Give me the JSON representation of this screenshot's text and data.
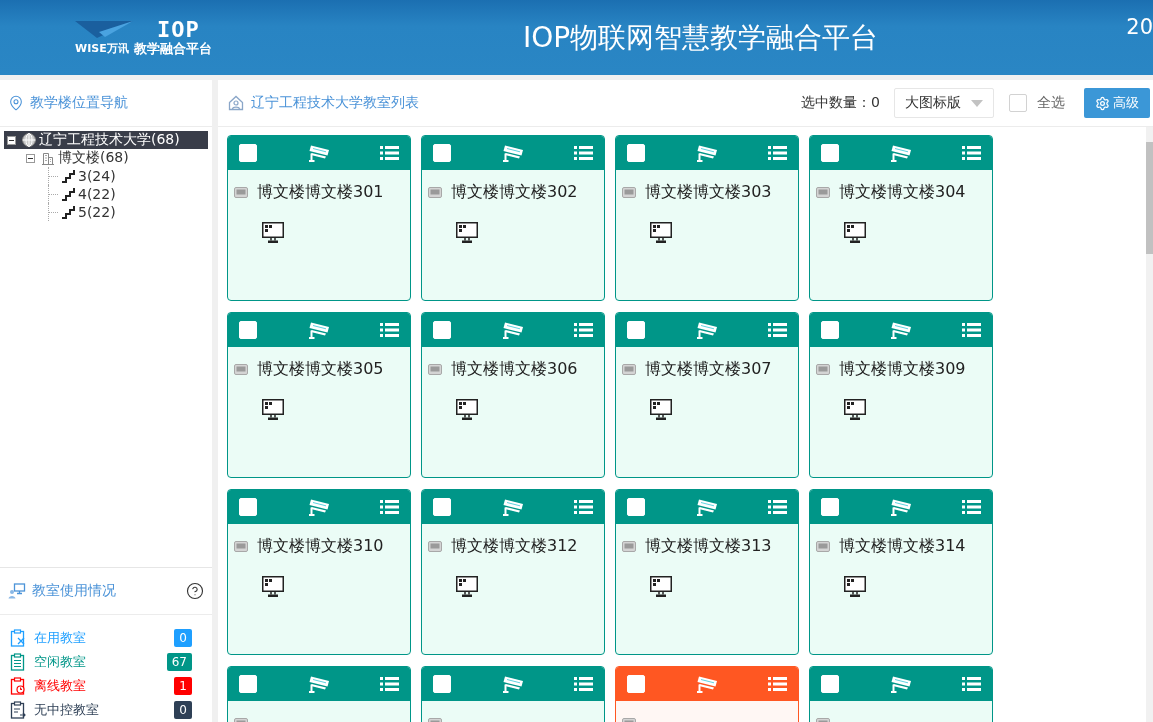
{
  "header": {
    "logo": {
      "mark": "IOP",
      "brand": "WISE万讯",
      "subtitle": "教学融合平台"
    },
    "title": "IOP物联网智慧教学融合平台",
    "right_text": "20"
  },
  "sidebar": {
    "nav_title": "教学楼位置导航",
    "tree": [
      {
        "label": "辽宁工程技术大学(68)",
        "kind": "campus",
        "selected": true,
        "expanded": true,
        "children": [
          {
            "label": "博文楼(68)",
            "kind": "building",
            "selected": false,
            "expanded": true,
            "children": [
              {
                "label": "3(24)",
                "kind": "floor",
                "selected": false
              },
              {
                "label": "4(22)",
                "kind": "floor",
                "selected": false
              },
              {
                "label": "5(22)",
                "kind": "floor",
                "selected": false
              }
            ]
          }
        ]
      }
    ],
    "usage_title": "教室使用情况",
    "usage": [
      {
        "label": "在用教室",
        "count": "0",
        "kind": "in-use",
        "color": "#1e9fff"
      },
      {
        "label": "空闲教室",
        "count": "67",
        "kind": "idle",
        "color": "#009688"
      },
      {
        "label": "离线教室",
        "count": "1",
        "kind": "offline",
        "color": "#ff0000"
      },
      {
        "label": "无中控教室",
        "count": "0",
        "kind": "no-control",
        "color": "#2f4056"
      }
    ]
  },
  "main": {
    "title": "辽宁工程技术大学教室列表",
    "selected_count": "选中数量：0",
    "view_select": {
      "value": "大图标版"
    },
    "select_all": {
      "label": "全选",
      "checked": false
    },
    "advanced_button": "高级",
    "rooms": [
      {
        "name": "博文楼博文楼301",
        "offline": false,
        "checked": false
      },
      {
        "name": "博文楼博文楼302",
        "offline": false,
        "checked": false
      },
      {
        "name": "博文楼博文楼303",
        "offline": false,
        "checked": false
      },
      {
        "name": "博文楼博文楼304",
        "offline": false,
        "checked": false
      },
      {
        "name": "博文楼博文楼305",
        "offline": false,
        "checked": false
      },
      {
        "name": "博文楼博文楼306",
        "offline": false,
        "checked": false
      },
      {
        "name": "博文楼博文楼307",
        "offline": false,
        "checked": false
      },
      {
        "name": "博文楼博文楼309",
        "offline": false,
        "checked": false
      },
      {
        "name": "博文楼博文楼310",
        "offline": false,
        "checked": false
      },
      {
        "name": "博文楼博文楼312",
        "offline": false,
        "checked": false
      },
      {
        "name": "博文楼博文楼313",
        "offline": false,
        "checked": false
      },
      {
        "name": "博文楼博文楼314",
        "offline": false,
        "checked": false
      },
      {
        "offline": false,
        "checked": false
      },
      {
        "offline": false,
        "checked": false
      },
      {
        "offline": true,
        "checked": false
      },
      {
        "offline": false,
        "checked": false
      }
    ]
  }
}
